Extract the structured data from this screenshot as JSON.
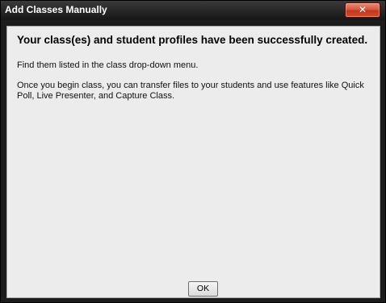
{
  "window": {
    "title": "Add Classes Manually",
    "close_icon": "close-icon",
    "close_glyph": "✕"
  },
  "content": {
    "heading": "Your class(es) and student profiles have been successfully created.",
    "paragraph_1": "Find them listed in the class drop-down menu.",
    "paragraph_2": "Once you begin class, you can transfer files to your students and use features like Quick Poll, Live Presenter, and Capture Class."
  },
  "buttons": {
    "ok_label": "OK"
  },
  "colors": {
    "titlebar": "#1c1c1c",
    "close_button": "#c7442a",
    "dialog_background": "#ececec"
  }
}
